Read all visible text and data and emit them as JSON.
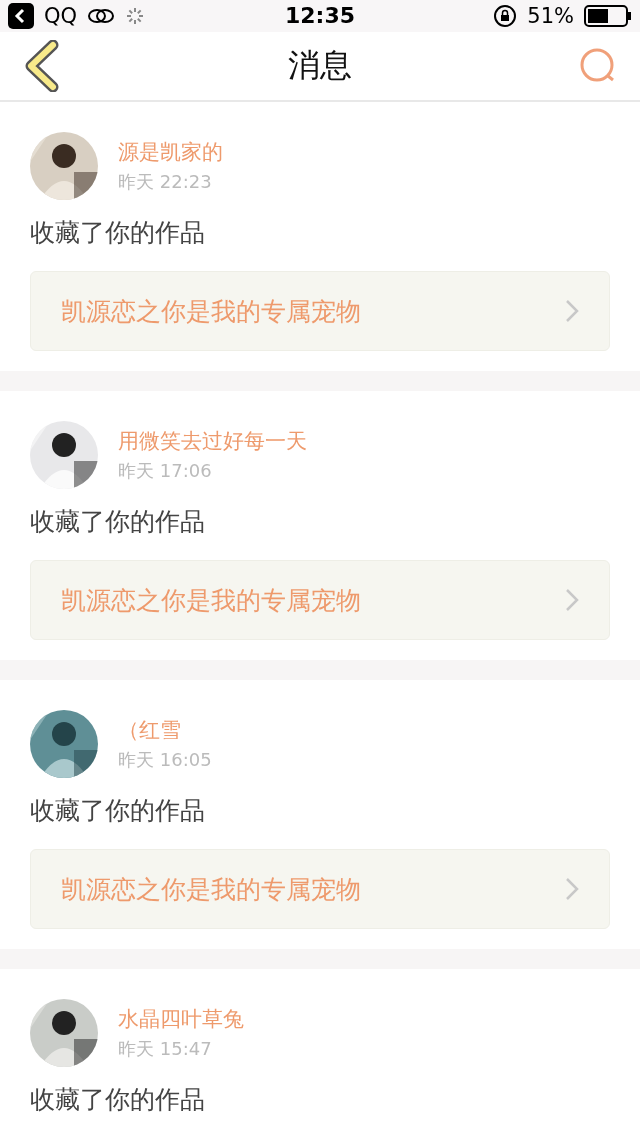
{
  "status_bar": {
    "back_app": "QQ",
    "time": "12:35",
    "battery": "51%"
  },
  "header": {
    "title": "消息"
  },
  "messages": [
    {
      "name": "源是凯家的",
      "time": "昨天 22:23",
      "action": "收藏了你的作品",
      "work": "凯源恋之你是我的专属宠物"
    },
    {
      "name": "用微笑去过好每一天",
      "time": "昨天 17:06",
      "action": "收藏了你的作品",
      "work": "凯源恋之你是我的专属宠物"
    },
    {
      "name": "（红雪",
      "time": "昨天 16:05",
      "action": "收藏了你的作品",
      "work": "凯源恋之你是我的专属宠物"
    },
    {
      "name": "水晶四叶草兔",
      "time": "昨天 15:47",
      "action": "收藏了你的作品"
    }
  ]
}
